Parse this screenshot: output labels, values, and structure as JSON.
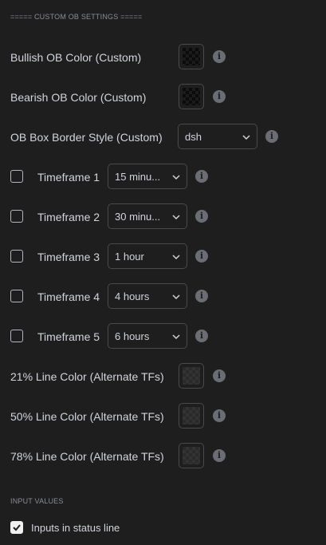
{
  "sections": {
    "custom_ob": "===== CUSTOM OB SETTINGS =====",
    "input_values": "INPUT VALUES"
  },
  "info_icon": "i",
  "colors": {
    "background": "#1e1e1e",
    "text": "#d1d4dc",
    "border": "#4a4a4a",
    "ob_swatch": "#0b0b0b"
  },
  "ob_colors": {
    "bullish_label": "Bullish OB Color (Custom)",
    "bearish_label": "Bearish OB Color (Custom)"
  },
  "border_style": {
    "label": "OB Box Border Style (Custom)",
    "value": "dsh"
  },
  "timeframes": [
    {
      "label": "Timeframe 1",
      "value": "15 minu...",
      "checked": false
    },
    {
      "label": "Timeframe 2",
      "value": "30 minu...",
      "checked": false
    },
    {
      "label": "Timeframe 3",
      "value": "1 hour",
      "checked": false
    },
    {
      "label": "Timeframe 4",
      "value": "4 hours",
      "checked": false
    },
    {
      "label": "Timeframe 5",
      "value": "6 hours",
      "checked": false
    }
  ],
  "line_colors": [
    {
      "label": "21% Line Color (Alternate TFs)"
    },
    {
      "label": "50% Line Color (Alternate TFs)"
    },
    {
      "label": "78% Line Color (Alternate TFs)"
    }
  ],
  "status_line": {
    "label": "Inputs in status line",
    "checked": true
  }
}
